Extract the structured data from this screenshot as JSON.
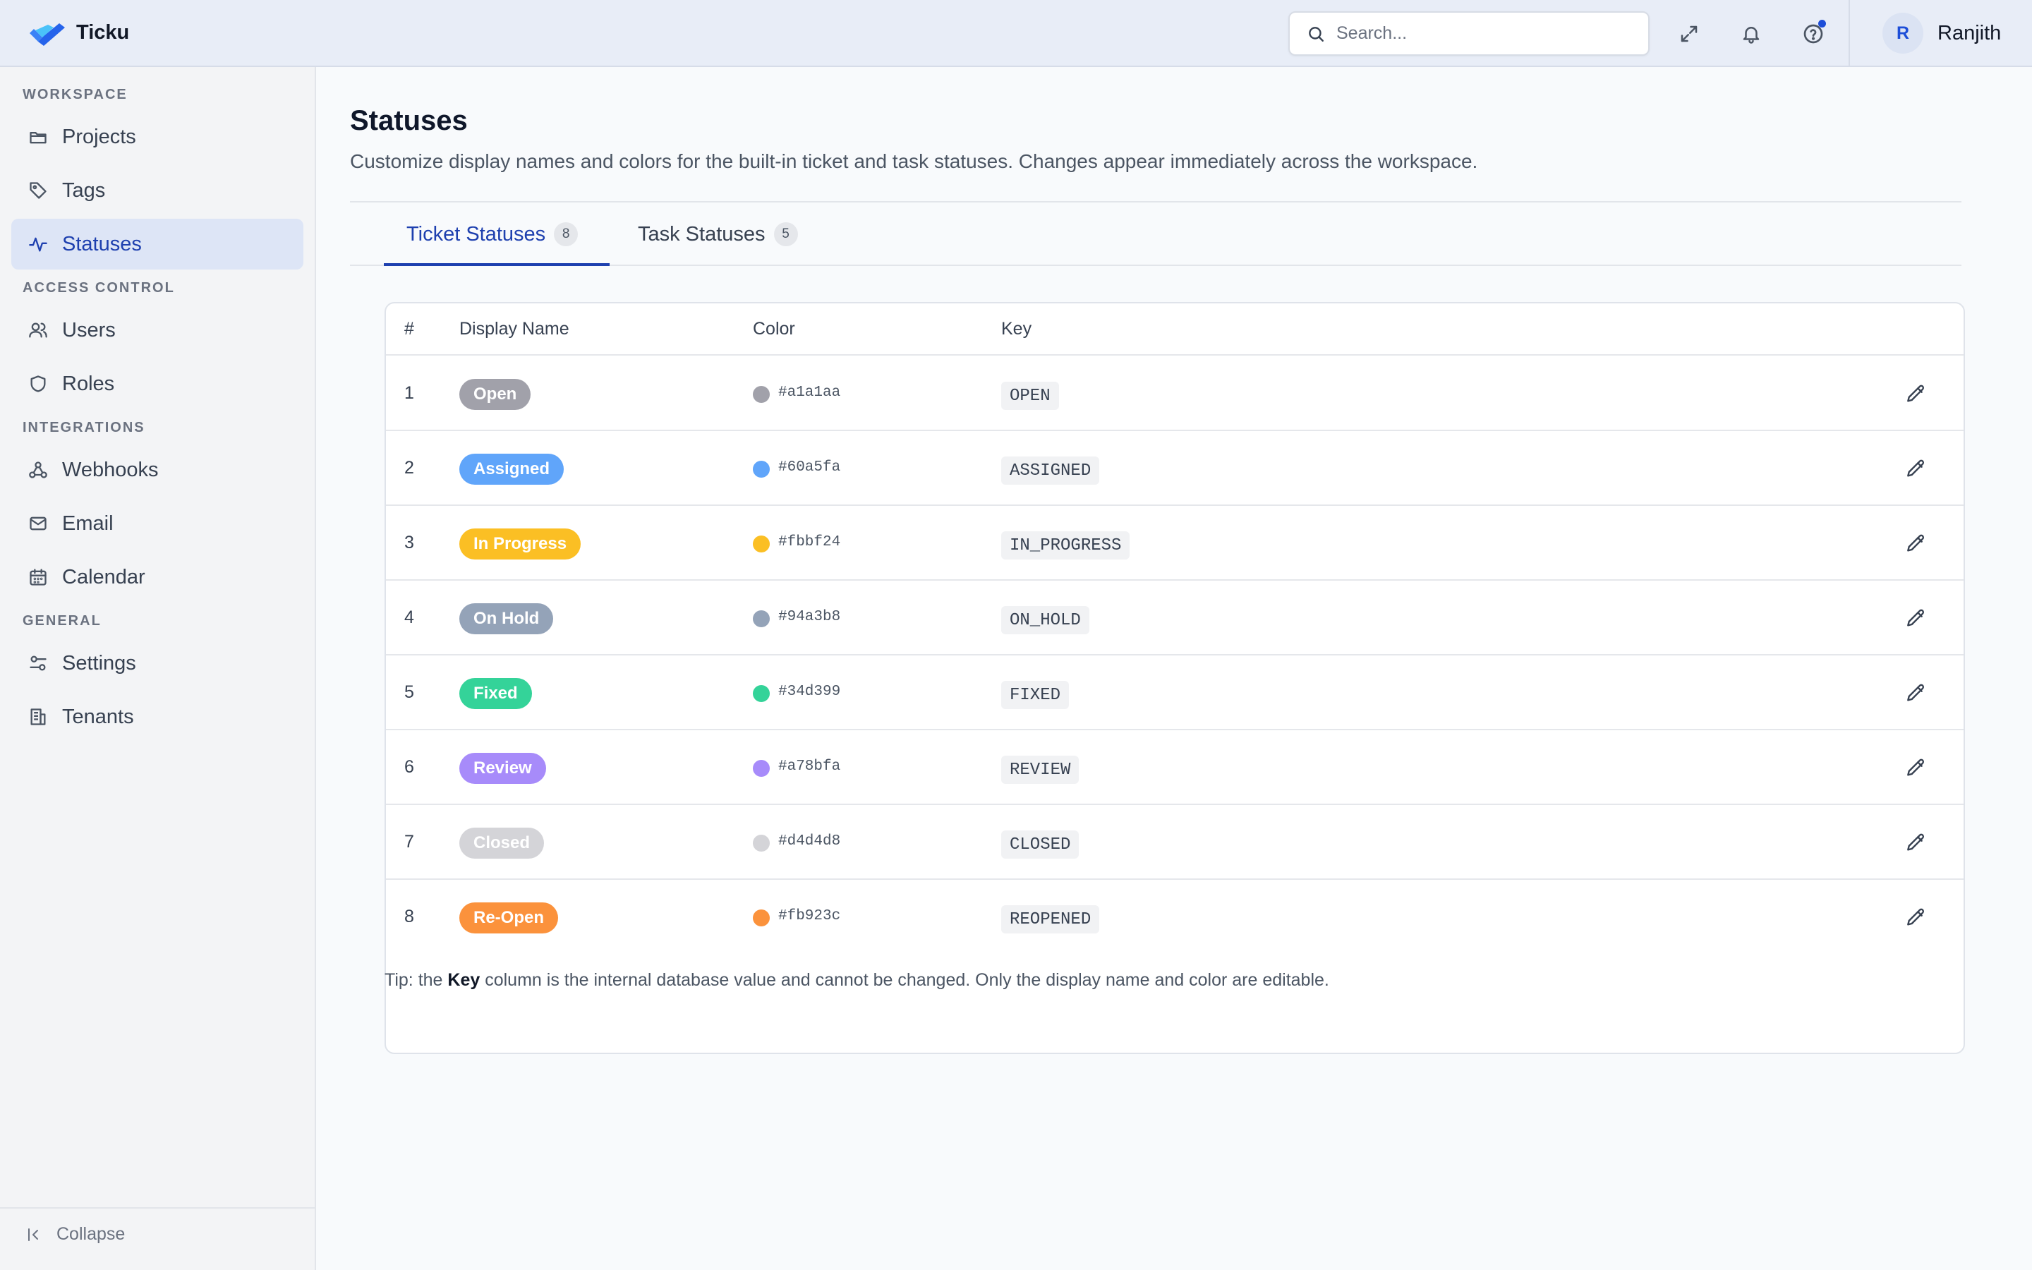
{
  "app": {
    "name": "Ticku"
  },
  "header": {
    "search_placeholder": "Search...",
    "user": {
      "initial": "R",
      "name": "Ranjith"
    }
  },
  "sidebar": {
    "sections": {
      "workspace": "WORKSPACE",
      "access_control": "ACCESS CONTROL",
      "integrations": "INTEGRATIONS",
      "general": "GENERAL"
    },
    "items": {
      "projects": "Projects",
      "tags": "Tags",
      "statuses": "Statuses",
      "users": "Users",
      "roles": "Roles",
      "webhooks": "Webhooks",
      "email": "Email",
      "calendar": "Calendar",
      "settings": "Settings",
      "tenants": "Tenants"
    },
    "collapse_label": "Collapse"
  },
  "page": {
    "title": "Statuses",
    "subtitle": "Customize display names and colors for the built-in ticket and task statuses. Changes appear immediately across the workspace.",
    "tabs": [
      {
        "label": "Ticket Statuses",
        "count": "8",
        "active": true
      },
      {
        "label": "Task Statuses",
        "count": "5",
        "active": false
      }
    ],
    "table": {
      "headers": {
        "num": "#",
        "display_name": "Display Name",
        "color": "Color",
        "key": "Key"
      },
      "rows": [
        {
          "num": "1",
          "name": "Open",
          "color": "#a1a1aa",
          "hex": "#a1a1aa",
          "key": "OPEN"
        },
        {
          "num": "2",
          "name": "Assigned",
          "color": "#60a5fa",
          "hex": "#60a5fa",
          "key": "ASSIGNED"
        },
        {
          "num": "3",
          "name": "In Progress",
          "color": "#fbbf24",
          "hex": "#fbbf24",
          "key": "IN_PROGRESS"
        },
        {
          "num": "4",
          "name": "On Hold",
          "color": "#94a3b8",
          "hex": "#94a3b8",
          "key": "ON_HOLD"
        },
        {
          "num": "5",
          "name": "Fixed",
          "color": "#34d399",
          "hex": "#34d399",
          "key": "FIXED"
        },
        {
          "num": "6",
          "name": "Review",
          "color": "#a78bfa",
          "hex": "#a78bfa",
          "key": "REVIEW"
        },
        {
          "num": "7",
          "name": "Closed",
          "color": "#d4d4d8",
          "hex": "#d4d4d8",
          "key": "CLOSED"
        },
        {
          "num": "8",
          "name": "Re-Open",
          "color": "#fb923c",
          "hex": "#fb923c",
          "key": "REOPENED"
        }
      ]
    },
    "tip": {
      "prefix": "Tip: the ",
      "bold": "Key",
      "suffix": " column is the internal database value and cannot be changed. Only the display name and color are editable."
    }
  },
  "colors": {
    "accent": "#1e40af",
    "notification_dot": "#1d4ed8"
  }
}
